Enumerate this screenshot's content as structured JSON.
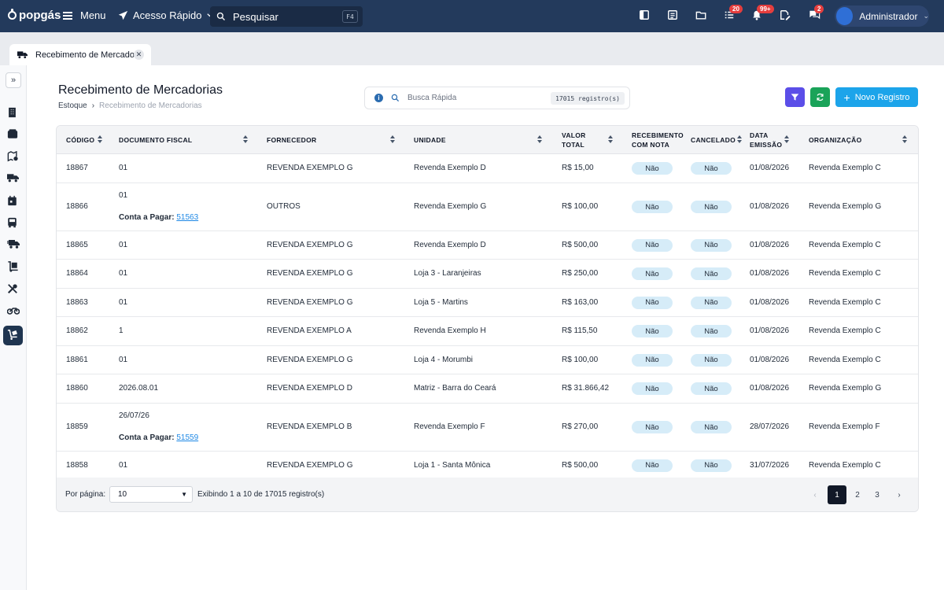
{
  "topbar": {
    "logo": "popgás",
    "menu_label": "Menu",
    "quick_access_label": "Acesso Rápido",
    "search_placeholder": "Pesquisar",
    "search_shortcut": "F4",
    "tasks_badge": "20",
    "notifications_badge": "99+",
    "chat_badge": "2",
    "user_name": "Administrador"
  },
  "tabs": [
    {
      "label": "Recebimento de Mercado...",
      "icon": "truck-icon"
    }
  ],
  "page": {
    "title": "Recebimento de Mercadorias",
    "breadcrumb": {
      "parent": "Estoque",
      "separator": "›",
      "current": "Recebimento de Mercadorias"
    },
    "quick_search": {
      "placeholder": "Busca Rápida",
      "count": "17015 registro(s)"
    },
    "new_button_label": "Novo Registro"
  },
  "table": {
    "headers": {
      "codigo": "CÓDIGO",
      "documento": "DOCUMENTO FISCAL",
      "fornecedor": "FORNECEDOR",
      "unidade": "UNIDADE",
      "valor_1": "VALOR",
      "valor_2": "TOTAL",
      "recebimento_1": "RECEBIMENTO",
      "recebimento_2": "COM NOTA",
      "cancelado": "CANCELADO",
      "data_1": "DATA",
      "data_2": "EMISSÃO",
      "organizacao": "ORGANIZAÇÃO"
    },
    "rows": [
      {
        "codigo": "18867",
        "documento": "01",
        "fornecedor": "REVENDA EXEMPLO G",
        "unidade": "Revenda Exemplo D",
        "valor": "R$ 15,00",
        "recebimento": "Não",
        "cancelado": "Não",
        "data": "01/08/2026",
        "organizacao": "Revenda Exemplo C"
      },
      {
        "codigo": "18866",
        "documento": "01",
        "conta_label": "Conta a Pagar:",
        "conta_link": "51563",
        "fornecedor": "OUTROS",
        "unidade": "Revenda Exemplo G",
        "valor": "R$ 100,00",
        "recebimento": "Não",
        "cancelado": "Não",
        "data": "01/08/2026",
        "organizacao": "Revenda Exemplo G"
      },
      {
        "codigo": "18865",
        "documento": "01",
        "fornecedor": "REVENDA EXEMPLO G",
        "unidade": "Revenda Exemplo D",
        "valor": "R$ 500,00",
        "recebimento": "Não",
        "cancelado": "Não",
        "data": "01/08/2026",
        "organizacao": "Revenda Exemplo C"
      },
      {
        "codigo": "18864",
        "documento": "01",
        "fornecedor": "REVENDA EXEMPLO G",
        "unidade": "Loja 3 - Laranjeiras",
        "valor": "R$ 250,00",
        "recebimento": "Não",
        "cancelado": "Não",
        "data": "01/08/2026",
        "organizacao": "Revenda Exemplo C"
      },
      {
        "codigo": "18863",
        "documento": "01",
        "fornecedor": "REVENDA EXEMPLO G",
        "unidade": "Loja 5 - Martins",
        "valor": "R$ 163,00",
        "recebimento": "Não",
        "cancelado": "Não",
        "data": "01/08/2026",
        "organizacao": "Revenda Exemplo C"
      },
      {
        "codigo": "18862",
        "documento": "1",
        "fornecedor": "REVENDA EXEMPLO A",
        "unidade": "Revenda Exemplo H",
        "valor": "R$ 115,50",
        "recebimento": "Não",
        "cancelado": "Não",
        "data": "01/08/2026",
        "organizacao": "Revenda Exemplo C"
      },
      {
        "codigo": "18861",
        "documento": "01",
        "fornecedor": "REVENDA EXEMPLO G",
        "unidade": "Loja 4 - Morumbi",
        "valor": "R$ 100,00",
        "recebimento": "Não",
        "cancelado": "Não",
        "data": "01/08/2026",
        "organizacao": "Revenda Exemplo C"
      },
      {
        "codigo": "18860",
        "documento": "2026.08.01",
        "fornecedor": "REVENDA EXEMPLO D",
        "unidade": "Matriz - Barra do Ceará",
        "valor": "R$ 31.866,42",
        "recebimento": "Não",
        "cancelado": "Não",
        "data": "01/08/2026",
        "organizacao": "Revenda Exemplo G"
      },
      {
        "codigo": "18859",
        "documento": "26/07/26",
        "conta_label": "Conta a Pagar:",
        "conta_link": "51559",
        "fornecedor": "REVENDA EXEMPLO B",
        "unidade": "Revenda Exemplo F",
        "valor": "R$ 270,00",
        "recebimento": "Não",
        "cancelado": "Não",
        "data": "28/07/2026",
        "organizacao": "Revenda Exemplo F"
      },
      {
        "codigo": "18858",
        "documento": "01",
        "fornecedor": "REVENDA EXEMPLO G",
        "unidade": "Loja 1 - Santa Mônica",
        "valor": "R$ 500,00",
        "recebimento": "Não",
        "cancelado": "Não",
        "data": "31/07/2026",
        "organizacao": "Revenda Exemplo C"
      }
    ]
  },
  "footer": {
    "per_page_label": "Por página:",
    "per_page_value": "10",
    "showing_text": "Exibindo 1 a 10 de 17015 registro(s)",
    "pages": [
      "1",
      "2",
      "3"
    ],
    "prev": "‹",
    "next": "›"
  },
  "colors": {
    "topbar": "#233a5c",
    "primary": "#1ca4ea",
    "filter": "#5b4ee8",
    "refresh": "#1aa359",
    "badge": "#e53e3e",
    "pill": "#d6ecf8"
  }
}
